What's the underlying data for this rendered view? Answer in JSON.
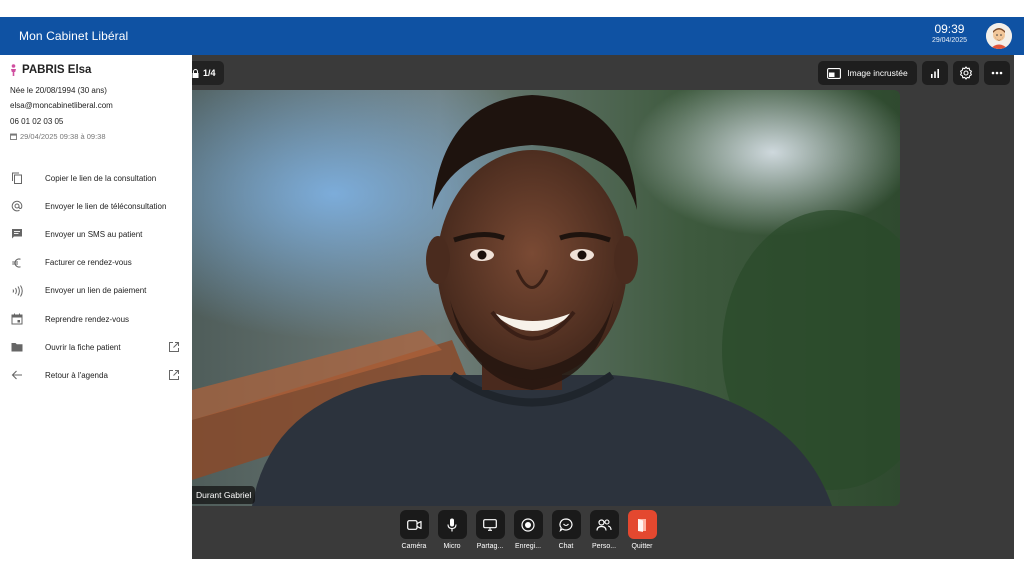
{
  "header": {
    "title": "Mon Cabinet Libéral",
    "time": "09:39",
    "date": "29/04/2025"
  },
  "patient": {
    "name": "PABRIS Elsa",
    "birth": "Née le 20/08/1994 (30 ans)",
    "email": "elsa@moncabinetliberal.com",
    "phone": "06 01 02 03 05",
    "appointment": "29/04/2025 09:38 à 09:38"
  },
  "actions": [
    {
      "label": "Copier le lien de la consultation",
      "icon": "copy-icon"
    },
    {
      "label": "Envoyer le lien de téléconsultation",
      "icon": "at-icon"
    },
    {
      "label": "Envoyer un SMS au patient",
      "icon": "sms-icon"
    },
    {
      "label": "Facturer ce rendez-vous",
      "icon": "euro-icon"
    },
    {
      "label": "Envoyer un lien de paiement",
      "icon": "contactless-icon"
    },
    {
      "label": "Reprendre rendez-vous",
      "icon": "calendar-icon"
    },
    {
      "label": "Ouvrir la fiche patient",
      "icon": "folder-icon"
    },
    {
      "label": "Retour à l'agenda",
      "icon": "arrow-left-icon"
    }
  ],
  "stage": {
    "participant_counter": "1/4",
    "pip_label": "Image incrustée",
    "participant_name": "Durant Gabriel"
  },
  "controls": [
    {
      "label": "Caméra",
      "icon": "camera-icon"
    },
    {
      "label": "Micro",
      "icon": "microphone-icon"
    },
    {
      "label": "Partag...",
      "icon": "screen-share-icon"
    },
    {
      "label": "Enregi...",
      "icon": "record-icon"
    },
    {
      "label": "Chat",
      "icon": "chat-icon"
    },
    {
      "label": "Perso...",
      "icon": "people-icon"
    },
    {
      "label": "Quitter",
      "icon": "leave-icon"
    }
  ],
  "colors": {
    "header": "#0f52a3",
    "stage": "#3a3a3a",
    "quit": "#e4482f",
    "female": "#d04fa0"
  }
}
